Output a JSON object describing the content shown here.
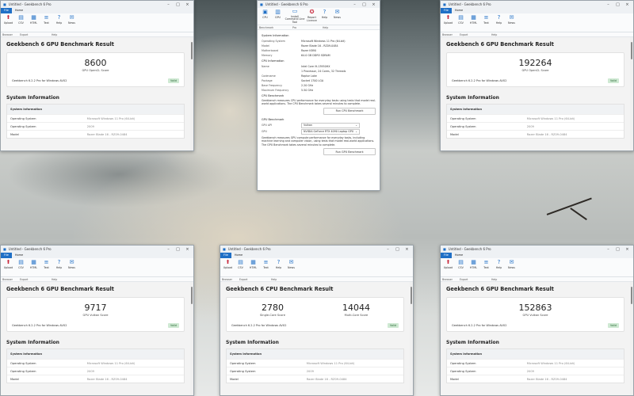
{
  "window_title": "Untitled - Geekbench 6 Pro",
  "window_title_short": "Untitled - Geekbench 6 Pro",
  "tabs": [
    "File",
    "Home"
  ],
  "ribbon": {
    "buttons": [
      "Upload",
      "CSV",
      "HTML",
      "Text",
      "Help",
      "News"
    ],
    "groups": [
      "Browser",
      "Export",
      "Help"
    ]
  },
  "result_title": "Geekbench 6 GPU Benchmark Result",
  "cpu_result_title": "Geekbench 6 CPU Benchmark Result",
  "valid": "Valid",
  "version": "Geekbench 6.2.2 Pro for Windows AVX2",
  "system_information": "System Information",
  "sysinfo_rows": [
    {
      "k": "Operating System",
      "v": "Microsoft Windows 11 Pro (64-bit)"
    },
    {
      "k": "Operating System",
      "v": "2009"
    },
    {
      "k": "Model",
      "v": "Razer Blade 16 - RZ09-0484"
    }
  ],
  "windows": {
    "tl": {
      "score": "8600",
      "label": "GPU OpenCL Score"
    },
    "tr": {
      "score": "192264",
      "label": "GPU OpenCL Score"
    },
    "bl": {
      "score": "9717",
      "label": "GPU Vulkan Score"
    },
    "br": {
      "score": "152863",
      "label": "GPU Vulkan Score"
    },
    "bm": {
      "single": "2780",
      "single_label": "Single-Core Score",
      "multi": "14044",
      "multi_label": "Multi-Core Score"
    }
  },
  "center": {
    "ribbon": {
      "buttons": [
        "CPU",
        "GPU",
        "Install Command Line Tool",
        "Report Licence",
        "Help",
        "News"
      ],
      "groups": [
        "Benchmark",
        "Pro",
        "Help"
      ]
    },
    "system_section": "System Information",
    "system": [
      {
        "k": "Operating System",
        "v": "Microsoft Windows 11 Pro (64-bit)"
      },
      {
        "k": "Model",
        "v": "Razer Blade 16 - RZ09-0484"
      },
      {
        "k": "Motherboard",
        "v": "Razer K890"
      },
      {
        "k": "Memory",
        "v": "64.0 GB DDR5 SDRAM"
      }
    ],
    "cpu_section": "CPU Information",
    "cpu": [
      {
        "k": "Name",
        "v": "Intel Core i9-13950HX"
      },
      {
        "k": "",
        "v": "1 Processor, 24 Cores, 32 Threads"
      },
      {
        "k": "Codename",
        "v": "Raptor Lake"
      },
      {
        "k": "Package",
        "v": "Socket 1700 LGA"
      },
      {
        "k": "Base Frequency",
        "v": "2.20 GHz"
      },
      {
        "k": "Maximum Frequency",
        "v": "5.50 GHz"
      }
    ],
    "cpu_bench_section": "CPU Benchmark",
    "cpu_bench_text": "Geekbench measures CPU performance for everyday tasks using tests that model real-world applications. The CPU Benchmark takes several minutes to complete.",
    "run_cpu": "Run CPU Benchmark",
    "gpu_bench_section": "GPU Benchmark",
    "gpu_api_label": "GPU API",
    "gpu_api_value": "Vulkan",
    "gpu_label": "GPU",
    "gpu_value": "NVIDIA GeForce RTX 4090 Laptop GPU",
    "gpu_bench_text": "Geekbench measures GPU compute performance for everyday tasks, including machine learning and computer vision, using tests that model real-world applications. The GPU Benchmark takes several minutes to complete.",
    "run_gpu": "Run GPU Benchmark"
  },
  "icons": {
    "upload": "upload-icon",
    "csv": "csv-icon",
    "html": "html-icon",
    "text": "text-icon",
    "help": "help-icon",
    "news": "news-icon"
  }
}
